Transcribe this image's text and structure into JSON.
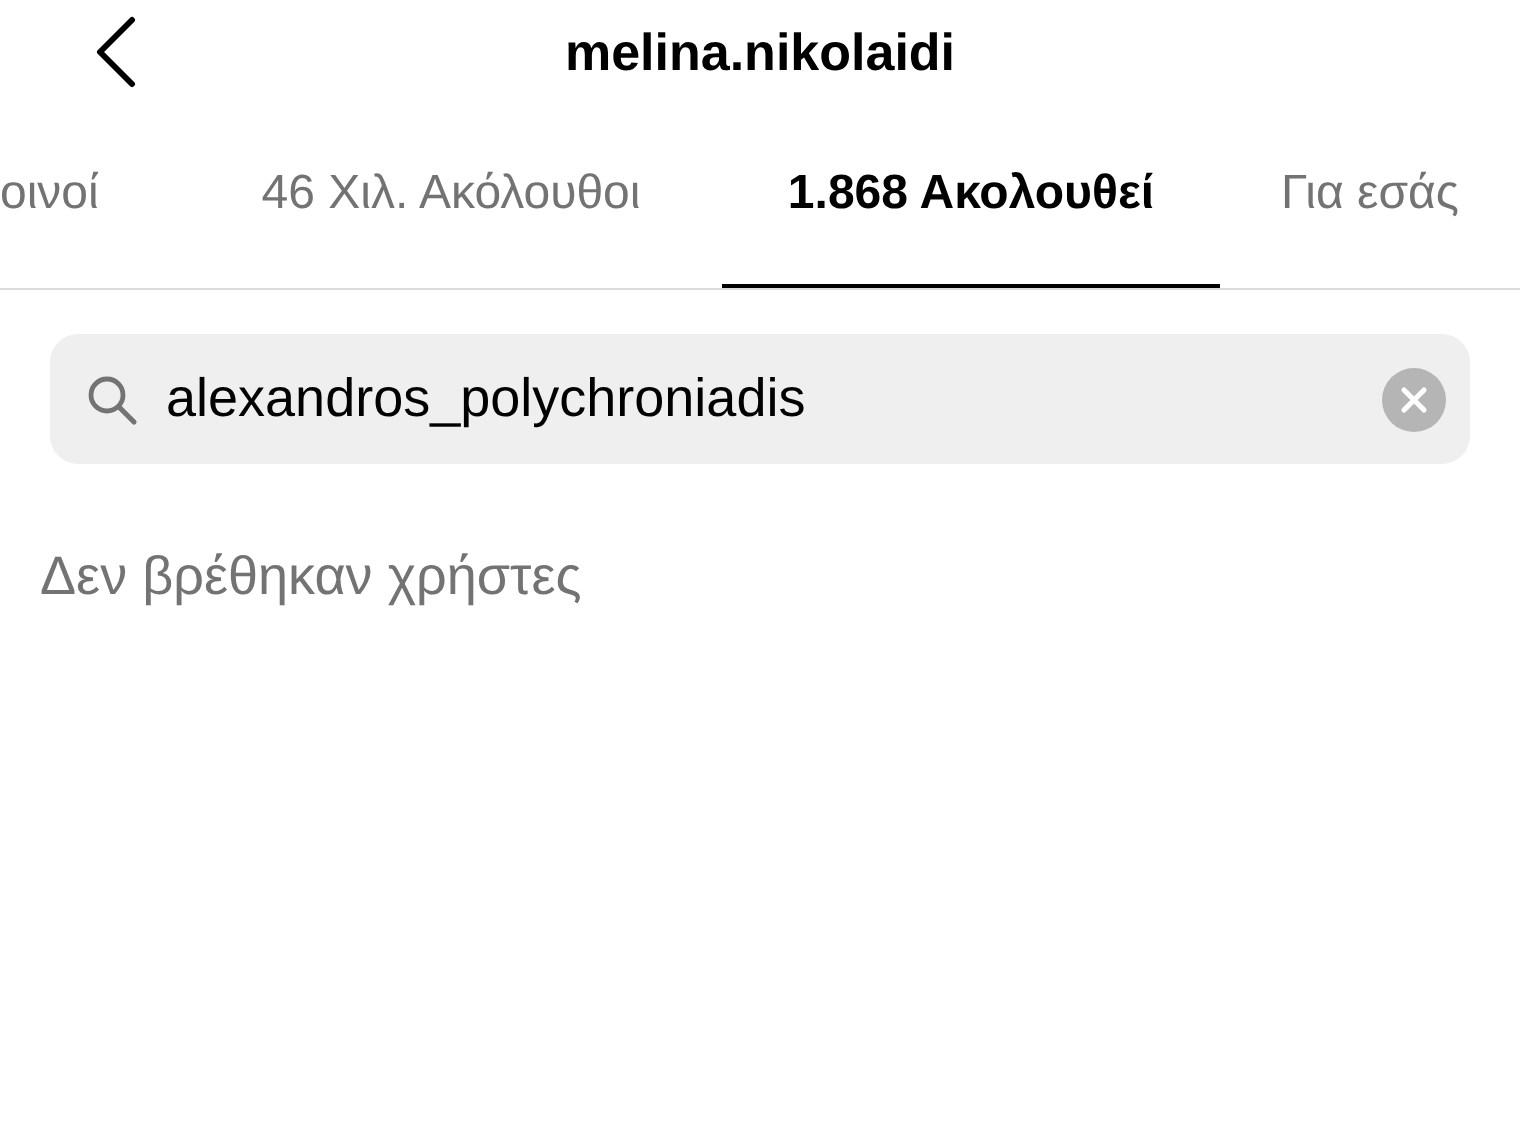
{
  "header": {
    "title": "melina.nikolaidi"
  },
  "tabs": [
    {
      "label": "οινοί",
      "selected": false
    },
    {
      "label": "46 Χιλ. Ακόλουθοι",
      "selected": false
    },
    {
      "label": "1.868 Ακολουθεί",
      "selected": true
    },
    {
      "label": "Για εσάς",
      "selected": false
    }
  ],
  "search": {
    "value": "alexandros_polychroniadis"
  },
  "empty_message": "Δεν βρέθηκαν χρήστες"
}
